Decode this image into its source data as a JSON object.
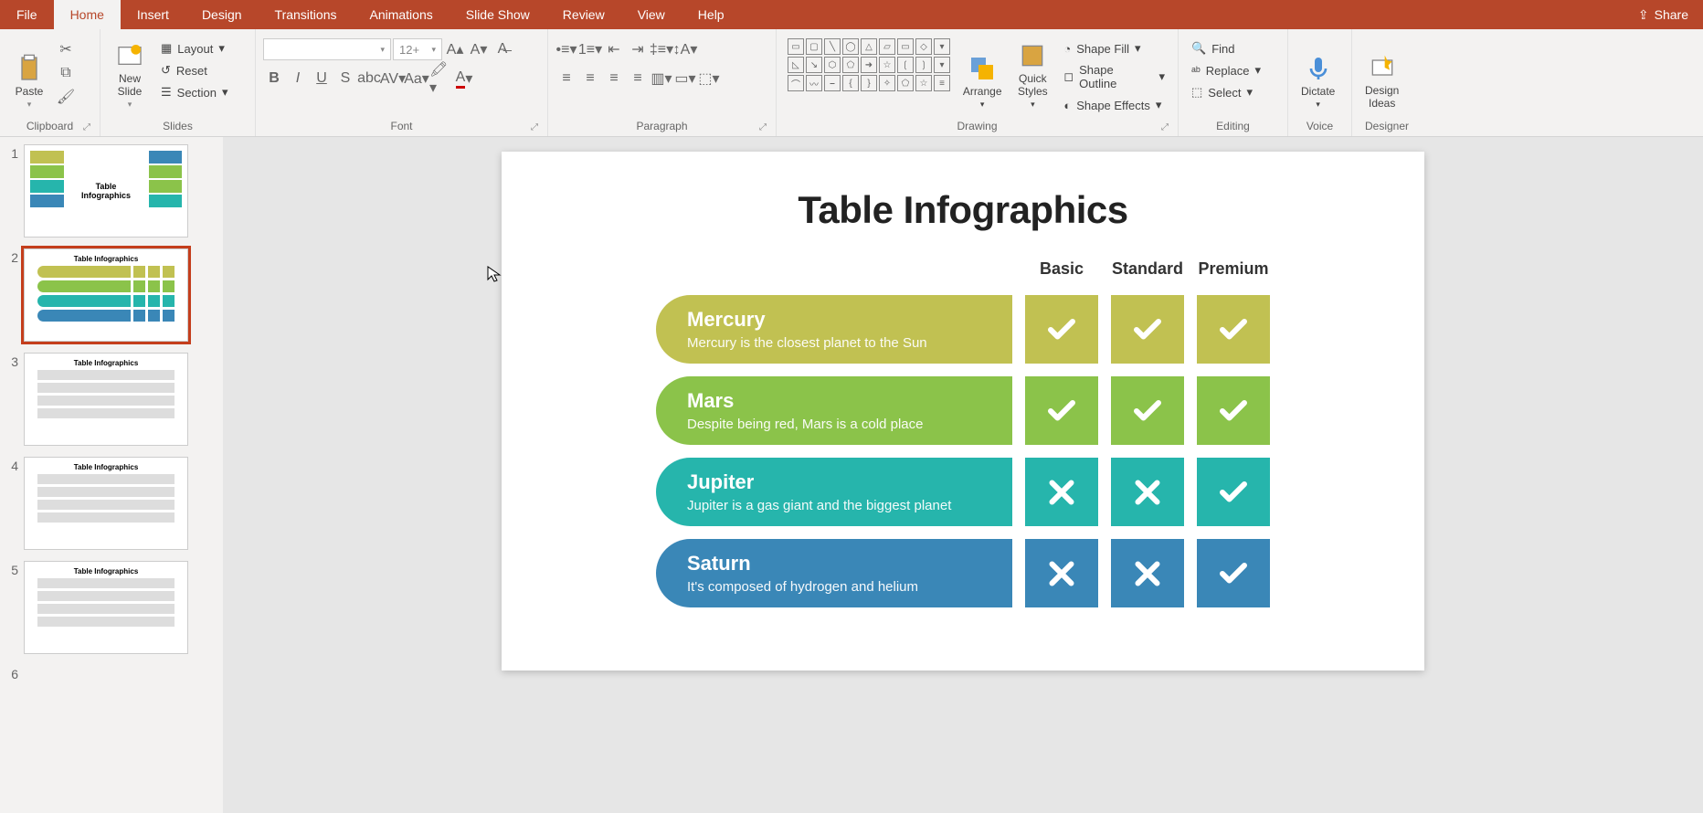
{
  "tabs": [
    "File",
    "Home",
    "Insert",
    "Design",
    "Transitions",
    "Animations",
    "Slide Show",
    "Review",
    "View",
    "Help"
  ],
  "active_tab": "Home",
  "share": "Share",
  "ribbon": {
    "clipboard": {
      "paste": "Paste",
      "label": "Clipboard"
    },
    "slides": {
      "new": "New\nSlide",
      "layout": "Layout",
      "reset": "Reset",
      "section": "Section",
      "label": "Slides"
    },
    "font": {
      "size": "12+",
      "label": "Font"
    },
    "paragraph": {
      "label": "Paragraph"
    },
    "drawing": {
      "arrange": "Arrange",
      "quick": "Quick\nStyles",
      "fill": "Shape Fill",
      "outline": "Shape Outline",
      "effects": "Shape Effects",
      "label": "Drawing"
    },
    "editing": {
      "find": "Find",
      "replace": "Replace",
      "select": "Select",
      "label": "Editing"
    },
    "voice": {
      "dictate": "Dictate",
      "label": "Voice"
    },
    "designer": {
      "ideas": "Design\nIdeas",
      "label": "Designer"
    }
  },
  "slide": {
    "title": "Table Infographics",
    "columns": [
      "Basic",
      "Standard",
      "Premium"
    ],
    "rows": [
      {
        "name": "Mercury",
        "desc": "Mercury is the closest planet to the Sun",
        "color": "c-olive",
        "cells": [
          "check",
          "check",
          "check"
        ]
      },
      {
        "name": "Mars",
        "desc": "Despite being red, Mars is a cold place",
        "color": "c-green",
        "cells": [
          "check",
          "check",
          "check"
        ]
      },
      {
        "name": "Jupiter",
        "desc": "Jupiter is a gas giant and the biggest planet",
        "color": "c-teal",
        "cells": [
          "cross",
          "cross",
          "check"
        ]
      },
      {
        "name": "Saturn",
        "desc": "It's composed of hydrogen and helium",
        "color": "c-blue",
        "cells": [
          "cross",
          "cross",
          "check"
        ]
      }
    ]
  },
  "thumbs": [
    1,
    2,
    3,
    4,
    5
  ],
  "active_thumb": 2
}
